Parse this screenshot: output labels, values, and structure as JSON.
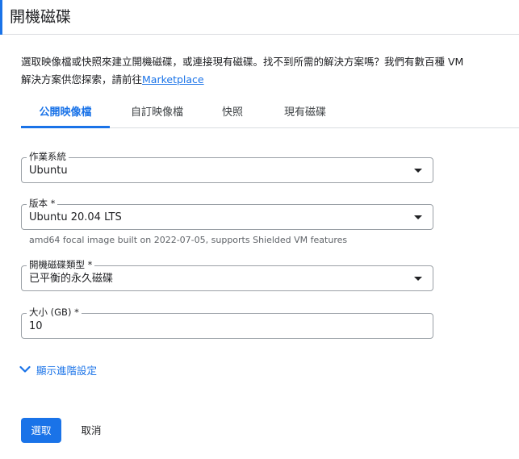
{
  "dialog": {
    "title": "開機磁碟",
    "description_main": "選取映像檔或快照來建立開機磁碟，或連接現有磁碟。找不到所需的解決方案嗎？我們有數百種 VM 解決方案供您探索，請前往",
    "description_link": "Marketplace"
  },
  "tabs": [
    {
      "label": "公開映像檔",
      "active": true
    },
    {
      "label": "自訂映像檔",
      "active": false
    },
    {
      "label": "快照",
      "active": false
    },
    {
      "label": "現有磁碟",
      "active": false
    }
  ],
  "fields": {
    "os": {
      "label": "作業系統",
      "value": "Ubuntu"
    },
    "version": {
      "label": "版本 *",
      "value": "Ubuntu 20.04 LTS",
      "hint": "amd64 focal image built on 2022-07-05, supports Shielded VM features"
    },
    "disk_type": {
      "label": "開機磁碟類型 *",
      "value": "已平衡的永久磁碟"
    },
    "size": {
      "label": "大小 (GB) *",
      "value": "10"
    }
  },
  "advanced": {
    "label": "顯示進階設定"
  },
  "buttons": {
    "select": "選取",
    "cancel": "取消"
  },
  "colors": {
    "accent": "#1a73e8",
    "border": "#9aa0a6",
    "divider": "#dadce0"
  }
}
